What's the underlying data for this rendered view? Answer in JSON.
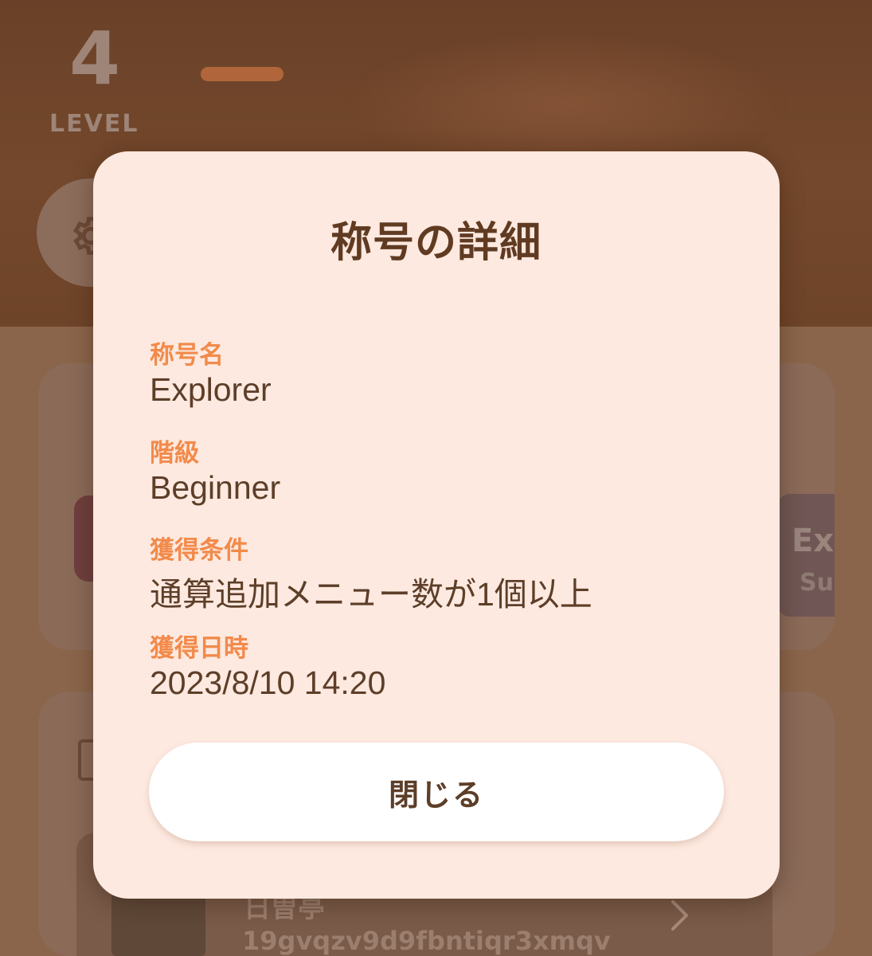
{
  "background": {
    "level_number": "4",
    "level_label": "LEVEL",
    "progress": 0.12,
    "chip_title": "Ex",
    "chip_subtitle": "Su",
    "list_item_name": "日曽亭",
    "list_item_id": "19gvqzv9d9fbntiqr3xmqv"
  },
  "modal": {
    "title": "称号の詳細",
    "fields": [
      {
        "label": "称号名",
        "value": "Explorer"
      },
      {
        "label": "階級",
        "value": "Beginner"
      },
      {
        "label": "獲得条件",
        "value": "通算追加メニュー数が1個以上"
      },
      {
        "label": "獲得日時",
        "value": "2023/8/10 14:20"
      }
    ],
    "close_label": "閉じる"
  },
  "colors": {
    "overlay_brown": "#8a654b",
    "modal_bg": "#fde9e0",
    "accent_orange": "#f28a4a",
    "text_brown": "#5d3e28"
  },
  "icons": {
    "settings": "gear-icon",
    "list_chevron": "chevron-right-icon"
  }
}
